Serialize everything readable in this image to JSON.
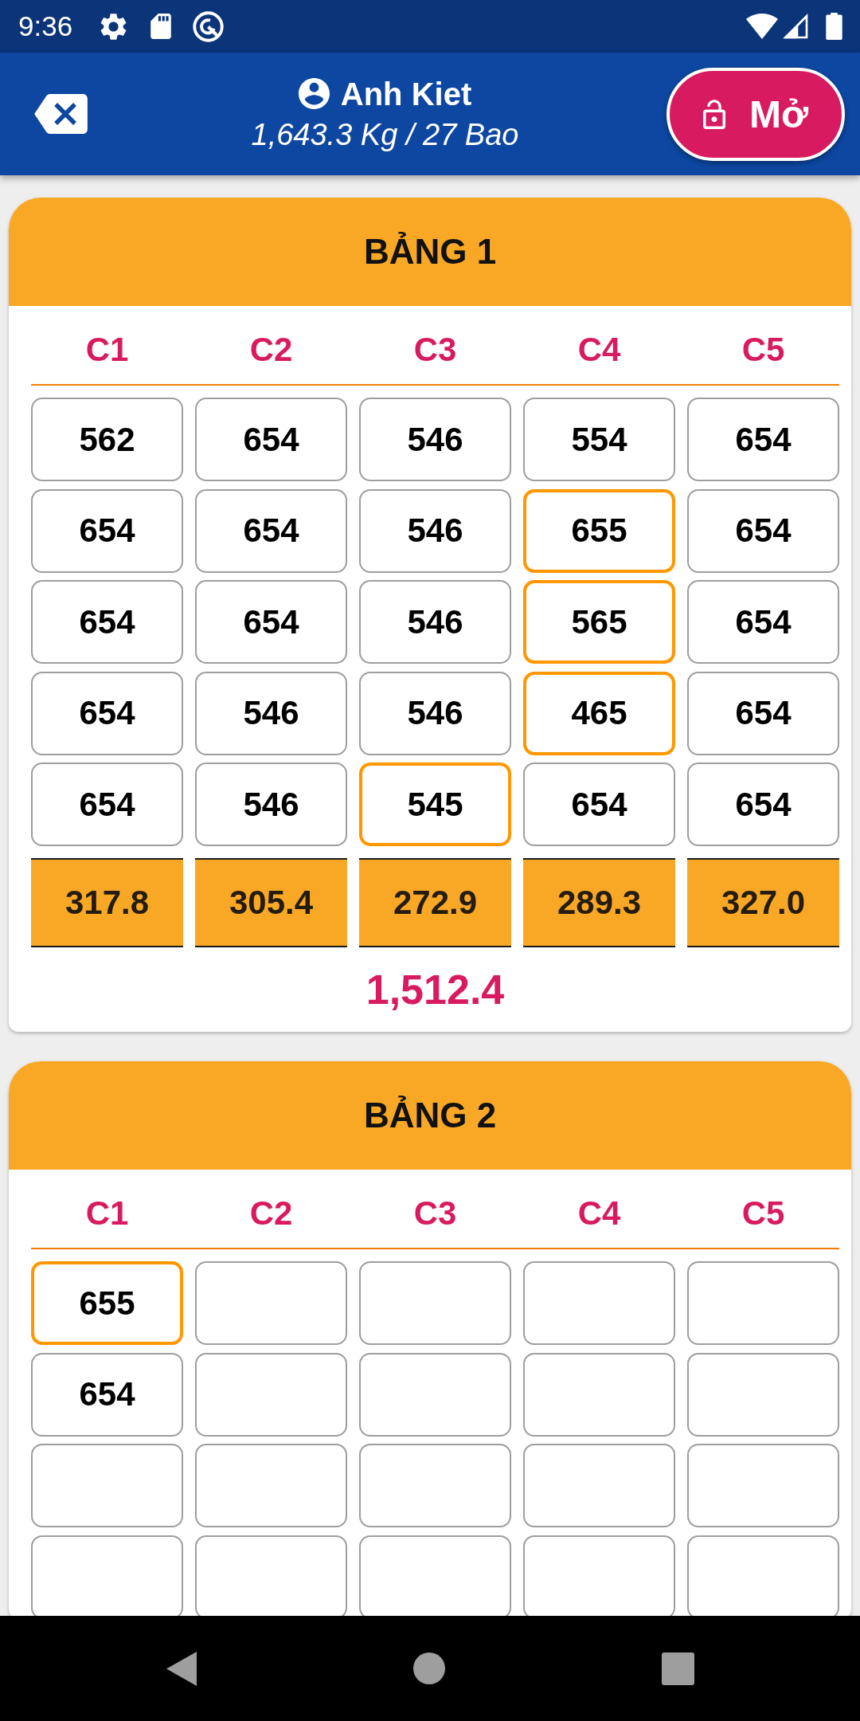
{
  "status_bar": {
    "time": "9:36"
  },
  "header": {
    "name": "Anh Kiet",
    "summary": "1,643.3 Kg / 27 Bao",
    "lock_button": {
      "label": "Mở"
    }
  },
  "tables": [
    {
      "title": "BẢNG 1",
      "columns": [
        "C1",
        "C2",
        "C3",
        "C4",
        "C5"
      ],
      "rows": [
        {
          "cells": [
            {
              "value": "562",
              "selected": false
            },
            {
              "value": "654",
              "selected": false
            },
            {
              "value": "546",
              "selected": false
            },
            {
              "value": "554",
              "selected": false
            },
            {
              "value": "654",
              "selected": false
            }
          ]
        },
        {
          "cells": [
            {
              "value": "654",
              "selected": false
            },
            {
              "value": "654",
              "selected": false
            },
            {
              "value": "546",
              "selected": false
            },
            {
              "value": "655",
              "selected": true
            },
            {
              "value": "654",
              "selected": false
            }
          ]
        },
        {
          "cells": [
            {
              "value": "654",
              "selected": false
            },
            {
              "value": "654",
              "selected": false
            },
            {
              "value": "546",
              "selected": false
            },
            {
              "value": "565",
              "selected": true
            },
            {
              "value": "654",
              "selected": false
            }
          ]
        },
        {
          "cells": [
            {
              "value": "654",
              "selected": false
            },
            {
              "value": "546",
              "selected": false
            },
            {
              "value": "546",
              "selected": false
            },
            {
              "value": "465",
              "selected": true
            },
            {
              "value": "654",
              "selected": false
            }
          ]
        },
        {
          "cells": [
            {
              "value": "654",
              "selected": false
            },
            {
              "value": "546",
              "selected": false
            },
            {
              "value": "545",
              "selected": true
            },
            {
              "value": "654",
              "selected": false
            },
            {
              "value": "654",
              "selected": false
            }
          ]
        }
      ],
      "totals": [
        "317.8",
        "305.4",
        "272.9",
        "289.3",
        "327.0"
      ],
      "grand_total": "1,512.4"
    },
    {
      "title": "BẢNG 2",
      "columns": [
        "C1",
        "C2",
        "C3",
        "C4",
        "C5"
      ],
      "rows": [
        {
          "cells": [
            {
              "value": "655",
              "selected": true
            },
            {
              "selected": false
            },
            {
              "selected": false
            },
            {
              "selected": false
            },
            {
              "selected": false
            }
          ]
        },
        {
          "cells": [
            {
              "value": "654",
              "selected": false
            },
            {
              "selected": false
            },
            {
              "selected": false
            },
            {
              "selected": false
            },
            {
              "selected": false
            }
          ]
        },
        {
          "cells": [
            {
              "selected": false
            },
            {
              "selected": false
            },
            {
              "selected": false
            },
            {
              "selected": false
            },
            {
              "selected": false
            }
          ]
        },
        {
          "cells": [
            {
              "selected": false
            },
            {
              "selected": false
            },
            {
              "selected": false
            },
            {
              "selected": false
            },
            {
              "selected": false
            }
          ]
        }
      ]
    }
  ]
}
